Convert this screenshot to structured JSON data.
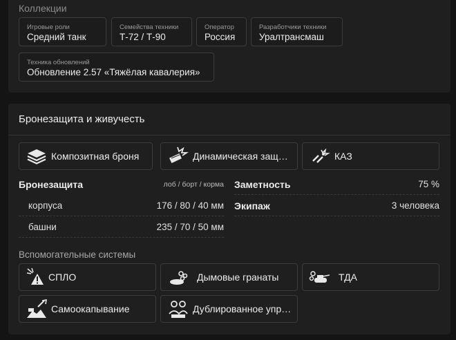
{
  "collections": {
    "title": "Коллекции",
    "tags": [
      {
        "caption": "Игровые роли",
        "value": "Средний танк"
      },
      {
        "caption": "Семейства техники",
        "value": "Т-72 / Т-90"
      },
      {
        "caption": "Оператор",
        "value": "Россия"
      },
      {
        "caption": "Разработчики техники",
        "value": "Уралтрансмаш"
      },
      {
        "caption": "Техника обновлений",
        "value": "Обновление 2.57 «Тяжёлая кавалерия»"
      }
    ]
  },
  "armor": {
    "title": "Бронезащита и живучесть",
    "features": [
      {
        "label": "Композитная броня",
        "icon": "composite-armor-icon"
      },
      {
        "label": "Динамическая защ…",
        "icon": "reactive-armor-icon"
      },
      {
        "label": "КАЗ",
        "icon": "aps-icon"
      }
    ],
    "protection": {
      "label": "Бронезащита",
      "hint": "лоб / борт / корма",
      "rows": [
        {
          "label": "корпуса",
          "value": "176 / 80 / 40 мм"
        },
        {
          "label": "башни",
          "value": "235 / 70 / 50 мм"
        }
      ]
    },
    "visibility": {
      "label": "Заметность",
      "value": "75 %"
    },
    "crew": {
      "label": "Экипаж",
      "value": "3 человека"
    },
    "aux_title": "Вспомогательные системы",
    "aux": [
      {
        "label": "СПЛО",
        "icon": "laser-warning-icon"
      },
      {
        "label": "Дымовые гранаты",
        "icon": "smoke-grenades-icon"
      },
      {
        "label": "ТДА",
        "icon": "smoke-exhaust-icon"
      },
      {
        "label": "Самоокапывание",
        "icon": "self-entrenching-icon"
      },
      {
        "label": "Дублированное упр…",
        "icon": "dual-controls-icon"
      }
    ]
  }
}
